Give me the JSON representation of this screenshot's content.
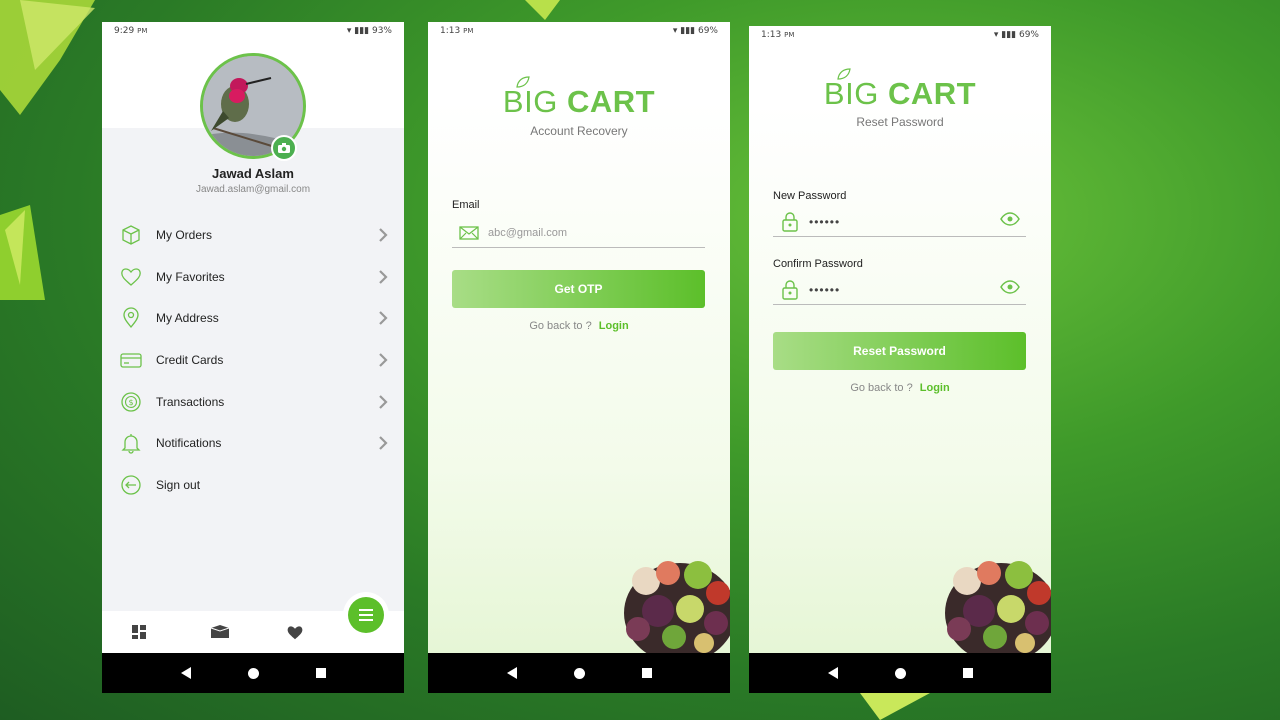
{
  "colors": {
    "brand": "#6cc24a",
    "brand_dark": "#5cbf2a",
    "background": "#3f9a2a"
  },
  "profile_screen": {
    "status": {
      "time": "9:29",
      "ampm": "PM",
      "battery": "93%"
    },
    "user": {
      "name": "Jawad Aslam",
      "email": "Jawad.aslam@gmail.com"
    },
    "menu": [
      {
        "label": "My Orders",
        "icon": "box-icon"
      },
      {
        "label": "My Favorites",
        "icon": "heart-icon"
      },
      {
        "label": "My Address",
        "icon": "location-pin-icon"
      },
      {
        "label": "Credit Cards",
        "icon": "credit-card-icon"
      },
      {
        "label": "Transactions",
        "icon": "dollar-cycle-icon"
      },
      {
        "label": "Notifications",
        "icon": "bell-icon"
      },
      {
        "label": "Sign out",
        "icon": "sign-out-icon"
      }
    ],
    "tabs": [
      "dashboard-icon",
      "box-icon",
      "heart-icon",
      "menu-icon"
    ]
  },
  "recovery_screen": {
    "status": {
      "time": "1:13",
      "ampm": "PM",
      "battery": "69%"
    },
    "logo_big": "BIG",
    "logo_cart": "CART",
    "subtitle": "Account Recovery",
    "email_label": "Email",
    "email_placeholder": "abc@gmail.com",
    "button": "Get OTP",
    "goback_text": "Go back to ?",
    "goback_link": "Login"
  },
  "reset_screen": {
    "status": {
      "time": "1:13",
      "ampm": "PM",
      "battery": "69%"
    },
    "logo_big": "BIG",
    "logo_cart": "CART",
    "subtitle": "Reset Password",
    "new_password_label": "New Password",
    "new_password_value": "••••••",
    "confirm_password_label": "Confirm Password",
    "confirm_password_value": "••••••",
    "button": "Reset Password",
    "goback_text": "Go back to ?",
    "goback_link": "Login"
  }
}
